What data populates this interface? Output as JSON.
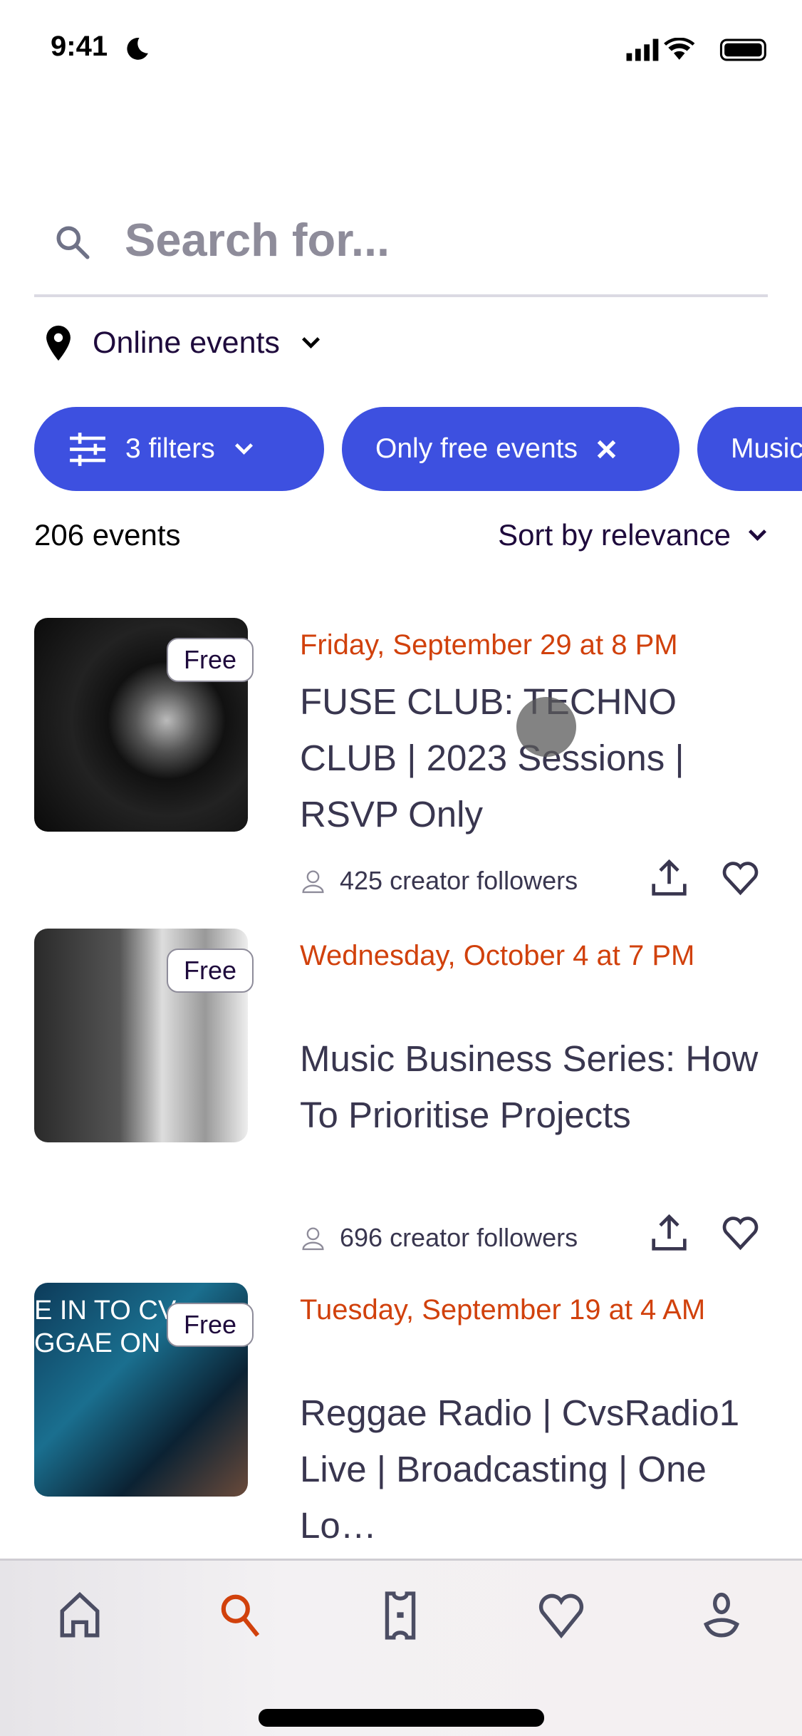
{
  "status": {
    "time": "9:41"
  },
  "search": {
    "placeholder": "Search for..."
  },
  "location": {
    "label": "Online events"
  },
  "filters": [
    {
      "label": "3 filters"
    },
    {
      "label": "Only free events"
    },
    {
      "label": "Music"
    }
  ],
  "results": {
    "count": "206 events",
    "sort": "Sort by relevance"
  },
  "events": [
    {
      "badge": "Free",
      "date": "Friday, September 29 at 8 PM",
      "title": "FUSE CLUB: TECHNO CLUB | 2023 Sessions | RSVP Only",
      "followers": "425 creator followers"
    },
    {
      "badge": "Free",
      "date": "Wednesday, October 4 at 7 PM",
      "title": "Music Business Series: How To Prioritise Projects",
      "followers": "696 creator followers"
    },
    {
      "badge": "Free",
      "date": "Tuesday, September 19 at 4 AM",
      "title": "Reggae Radio | CvsRadio1 Live | Broadcasting | One Lo…",
      "followers": "",
      "thumb_text": "E IN TO CV\nGGAE ON"
    }
  ],
  "tabbar": {
    "items": [
      "home",
      "search",
      "tickets",
      "likes",
      "profile"
    ],
    "active": "search"
  },
  "colors": {
    "accent": "#3d50e0",
    "date": "#d1410c",
    "active_tab": "#d1410c"
  }
}
